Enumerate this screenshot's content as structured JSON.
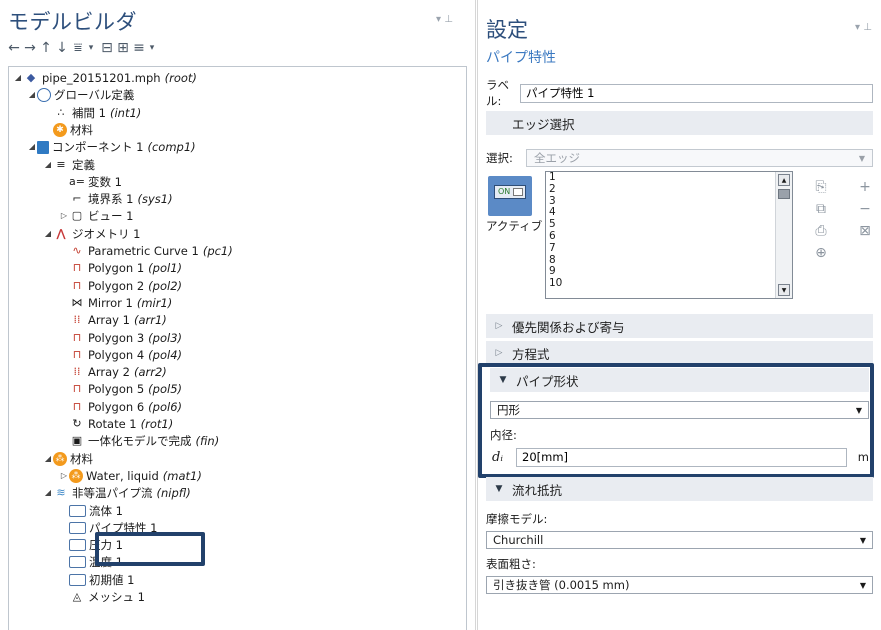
{
  "model_builder": {
    "title": "モデルビルダ",
    "toolbar": [
      "←",
      "→",
      "↑",
      "↓",
      "⩸",
      "▾",
      "⊟",
      "⊞",
      "≡",
      "▾"
    ],
    "tree": [
      {
        "toggle": "◢",
        "icon": "◆",
        "label": "pipe_20151201.mph",
        "tag": "(root)"
      },
      {
        "toggle": "◢",
        "icon": "",
        "label": "グローバル定義",
        "tag": ""
      },
      {
        "toggle": "",
        "icon": "∴",
        "label": "補間 1",
        "tag": "(int1)"
      },
      {
        "toggle": "",
        "icon": "✱",
        "label": "材料",
        "tag": ""
      },
      {
        "toggle": "◢",
        "icon": "",
        "label": "コンポーネント 1",
        "tag": "(comp1)"
      },
      {
        "toggle": "◢",
        "icon": "≡",
        "label": "定義",
        "tag": ""
      },
      {
        "toggle": "",
        "icon": "a=",
        "label": "変数 1",
        "tag": ""
      },
      {
        "toggle": "",
        "icon": "⌐",
        "label": "境界系 1",
        "tag": "(sys1)"
      },
      {
        "toggle": "▷",
        "icon": "▢",
        "label": "ビュー 1",
        "tag": ""
      },
      {
        "toggle": "◢",
        "icon": "⋀",
        "label": "ジオメトリ 1",
        "tag": ""
      },
      {
        "toggle": "",
        "icon": "∿",
        "label": "Parametric Curve 1",
        "tag": "(pc1)"
      },
      {
        "toggle": "",
        "icon": "⊓",
        "label": "Polygon 1",
        "tag": "(pol1)"
      },
      {
        "toggle": "",
        "icon": "⊓",
        "label": "Polygon 2",
        "tag": "(pol2)"
      },
      {
        "toggle": "",
        "icon": "⋈",
        "label": "Mirror 1",
        "tag": "(mir1)"
      },
      {
        "toggle": "",
        "icon": "⁞⁞",
        "label": "Array 1",
        "tag": "(arr1)"
      },
      {
        "toggle": "",
        "icon": "⊓",
        "label": "Polygon 3",
        "tag": "(pol3)"
      },
      {
        "toggle": "",
        "icon": "⊓",
        "label": "Polygon 4",
        "tag": "(pol4)"
      },
      {
        "toggle": "",
        "icon": "⁞⁞",
        "label": "Array 2",
        "tag": "(arr2)"
      },
      {
        "toggle": "",
        "icon": "⊓",
        "label": "Polygon 5",
        "tag": "(pol5)"
      },
      {
        "toggle": "",
        "icon": "⊓",
        "label": "Polygon 6",
        "tag": "(pol6)"
      },
      {
        "toggle": "",
        "icon": "↻",
        "label": "Rotate 1",
        "tag": "(rot1)"
      },
      {
        "toggle": "",
        "icon": "▣",
        "label": "一体化モデルで完成",
        "tag": "(fin)"
      },
      {
        "toggle": "◢",
        "icon": "⁂",
        "label": "材料",
        "tag": ""
      },
      {
        "toggle": "▷",
        "icon": "⁂",
        "label": "Water, liquid",
        "tag": "(mat1)"
      },
      {
        "toggle": "◢",
        "icon": "≋",
        "label": "非等温パイプ流",
        "tag": "(nipfl)"
      },
      {
        "toggle": "",
        "icon": "",
        "label": "流体 1",
        "tag": ""
      },
      {
        "toggle": "",
        "icon": "",
        "label": "パイプ特性 1",
        "tag": ""
      },
      {
        "toggle": "",
        "icon": "",
        "label": "圧力 1",
        "tag": ""
      },
      {
        "toggle": "",
        "icon": "",
        "label": "温度 1",
        "tag": ""
      },
      {
        "toggle": "",
        "icon": "",
        "label": "初期値 1",
        "tag": ""
      },
      {
        "toggle": "",
        "icon": "◬",
        "label": "メッシュ 1",
        "tag": ""
      }
    ]
  },
  "settings": {
    "title": "設定",
    "subtitle": "パイプ特性",
    "label_caption": "ラベル:",
    "label_value": "パイプ特性 1",
    "edge_section": "エッジ選択",
    "selection_caption": "選択:",
    "selection_value": "全エッジ",
    "switch_text": "ON",
    "active_label": "アクティブ",
    "edges": [
      "1",
      "2",
      "3",
      "4",
      "5",
      "6",
      "7",
      "8",
      "9",
      "10"
    ],
    "sections": {
      "priority": "優先関係および寄与",
      "equation": "方程式",
      "pipe_shape": "パイプ形状",
      "flow_resistance": "流れ抵抗"
    },
    "shape_value": "円形",
    "inner_diameter_caption": "内径:",
    "dia_symbol": "dᵢ",
    "dia_value": "20[mm]",
    "dia_unit": "m",
    "friction_caption": "摩擦モデル:",
    "friction_value": "Churchill",
    "roughness_caption": "表面粗さ:",
    "roughness_value": "引き抜き管 (0.0015 mm)"
  },
  "colors": {
    "title": "#2d4f7c",
    "subtitle": "#3b79c1",
    "highlight_box": "#22416b",
    "section_bg": "#e9ecf1",
    "active_button": "#5b8ac6"
  }
}
